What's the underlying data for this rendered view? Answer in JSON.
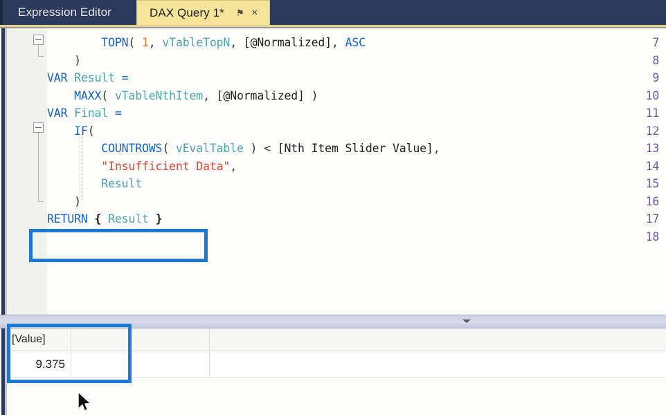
{
  "window": {
    "accent_blue": "#1f78d1",
    "tabbar_bg": "#2b3a5c",
    "active_tab_bg": "#f7e49b"
  },
  "tabs": [
    {
      "label": "Expression Editor",
      "active": false,
      "pin_icon": "",
      "close_icon": ""
    },
    {
      "label": "DAX Query 1*",
      "active": true,
      "pin_icon": "pin-icon",
      "close_icon": "close-icon"
    }
  ],
  "tab_icons": {
    "pin_glyph": "⚑",
    "close_glyph": "×"
  },
  "editor": {
    "first_visible_line": 7,
    "last_visible_line": 18,
    "line_numbers": [
      "7",
      "8",
      "9",
      "10",
      "11",
      "12",
      "13",
      "14",
      "15",
      "16",
      "17",
      "18"
    ],
    "lines": [
      {
        "num": "7",
        "text": "        TOPN( 1, vTableTopN, [@Normalized], ASC"
      },
      {
        "num": "8",
        "text": "    )"
      },
      {
        "num": "9",
        "text": "VAR Result ="
      },
      {
        "num": "10",
        "text": "    MAXX( vTableNthItem, [@Normalized] )"
      },
      {
        "num": "11",
        "text": "VAR Final ="
      },
      {
        "num": "12",
        "text": "    IF("
      },
      {
        "num": "13",
        "text": "        COUNTROWS( vEvalTable ) < [Nth Item Slider Value],"
      },
      {
        "num": "14",
        "text": "        \"Insufficient Data\","
      },
      {
        "num": "15",
        "text": "        Result"
      },
      {
        "num": "16",
        "text": "    )"
      },
      {
        "num": "17",
        "text": "RETURN { Result }"
      },
      {
        "num": "18",
        "text": ""
      }
    ],
    "tokens": {
      "line7": {
        "fn": "TOPN",
        "num": "1",
        "var1": "vTableTopN",
        "col": "[@Normalized]",
        "kw": "ASC"
      },
      "line8": {
        "punc": ")"
      },
      "line9": {
        "kw": "VAR",
        "var": "Result",
        "op": "="
      },
      "line10": {
        "fn": "MAXX",
        "var": "vTableNthItem",
        "col": "[@Normalized]"
      },
      "line11": {
        "kw": "VAR",
        "var": "Final",
        "op": "="
      },
      "line12": {
        "fn": "IF",
        "punc": "("
      },
      "line13": {
        "fn": "COUNTROWS",
        "var": "vEvalTable",
        "op": "<",
        "measure": "[Nth Item Slider Value]"
      },
      "line14": {
        "str": "\"Insufficient Data\""
      },
      "line15": {
        "var": "Result"
      },
      "line16": {
        "punc": ")"
      },
      "line17": {
        "kw": "RETURN",
        "open": "{",
        "var": "Result",
        "close": "}"
      }
    },
    "syntax_colors": {
      "keyword": "#1463c8",
      "function": "#1463c8",
      "variable": "#4aa5ad",
      "string": "#e1442c",
      "number": "#e07a20",
      "plain": "#222222",
      "line_number": "#6f58a8"
    },
    "highlight_box": {
      "target_line": "17",
      "color": "#1f78d1"
    }
  },
  "splitter": {
    "caret_icon": "chevron-down-icon"
  },
  "results": {
    "columns": [
      {
        "header": "[Value]"
      }
    ],
    "rows": [
      {
        "value": "9.375"
      }
    ],
    "highlight_box": {
      "color": "#1f78d1"
    }
  },
  "cursor": {
    "icon": "mouse-pointer-icon"
  }
}
